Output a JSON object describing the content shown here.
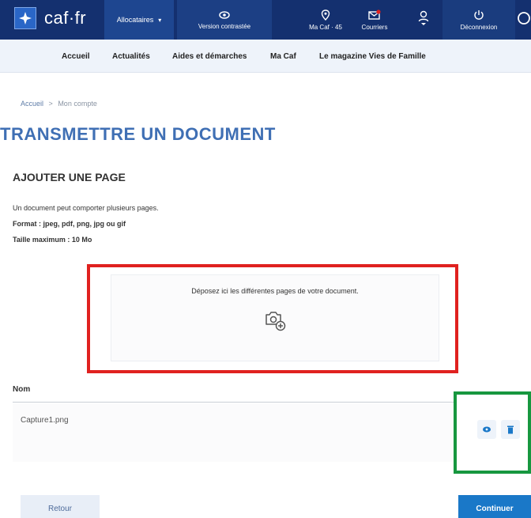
{
  "header": {
    "logo_text": "caf·fr",
    "role_selector": "Allocataires",
    "nav": {
      "version": "Version contrastée",
      "macaf": "Ma Caf · 45",
      "courriers": "Courriers",
      "deconnexion": "Déconnexion"
    }
  },
  "subnav": {
    "items": [
      "Accueil",
      "Actualités",
      "Aides et démarches",
      "Ma Caf",
      "Le magazine Vies de Famille"
    ]
  },
  "breadcrumb": {
    "home": "Accueil",
    "separator": ">",
    "current": "Mon compte"
  },
  "page": {
    "title": "TRANSMETTRE UN DOCUMENT",
    "section_title": "AJOUTER UNE PAGE",
    "info_pages": "Un document peut comporter plusieurs pages.",
    "info_format": "Format : jpeg, pdf, png, jpg ou gif",
    "info_size": "Taille maximum : 10 Mo"
  },
  "dropzone": {
    "text": "Déposez ici les différentes pages de votre document."
  },
  "table": {
    "header_name": "Nom",
    "rows": [
      {
        "name": "Capture1.png"
      }
    ]
  },
  "footer": {
    "back_label": "Retour",
    "continue_label": "Continuer"
  },
  "colors": {
    "header_bg": "#14306f",
    "title_blue": "#3f6fb4",
    "highlight_red": "#e0211f",
    "highlight_green": "#17973f",
    "primary_button": "#1a78c8"
  }
}
